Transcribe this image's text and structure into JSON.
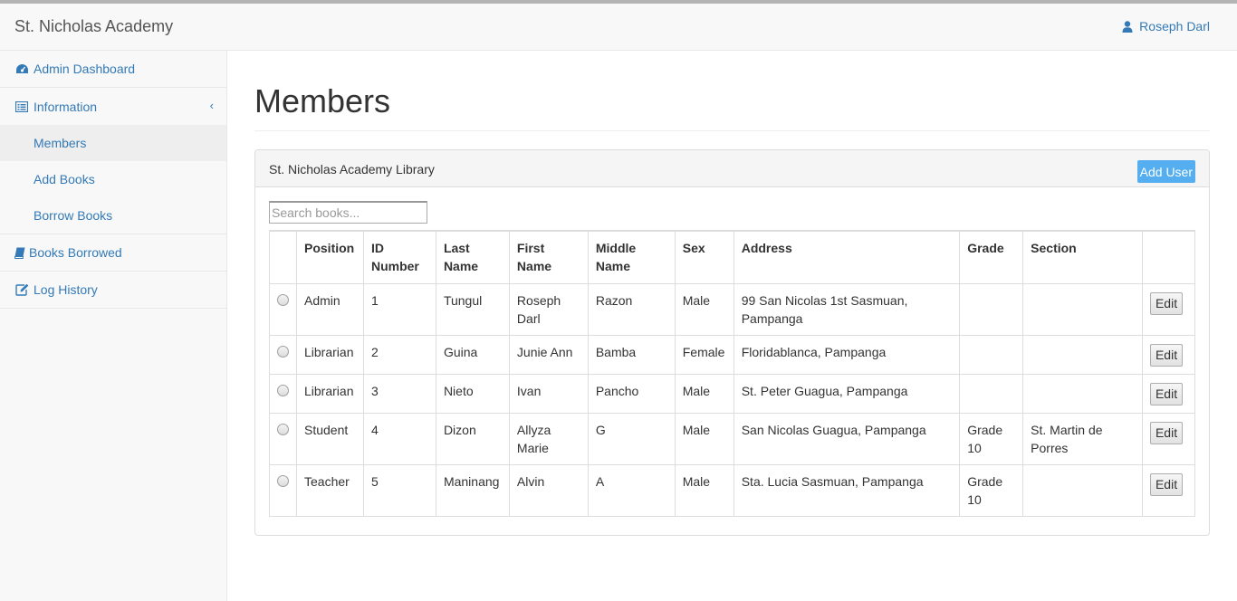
{
  "app": {
    "brand": "St. Nicholas Academy",
    "user_name": "Roseph Darl"
  },
  "sidebar": {
    "items": [
      {
        "label": "Admin Dashboard",
        "icon": "dashboard-icon"
      },
      {
        "label": "Information",
        "icon": "list-alt-icon"
      },
      {
        "label": "Members",
        "icon": ""
      },
      {
        "label": "Add Books",
        "icon": ""
      },
      {
        "label": "Borrow Books",
        "icon": ""
      },
      {
        "label": "Books Borrowed",
        "icon": "book-icon"
      },
      {
        "label": "Log History",
        "icon": "edit-icon"
      }
    ],
    "chevron": "‹"
  },
  "main": {
    "title": "Members",
    "panel_title": "St. Nicholas Academy Library",
    "add_button": "Add User",
    "search_placeholder": "Search books...",
    "columns": [
      {
        "l1": "Position",
        "l2": ""
      },
      {
        "l1": "ID",
        "l2": "Number"
      },
      {
        "l1": "Last",
        "l2": "Name"
      },
      {
        "l1": "First",
        "l2": "Name"
      },
      {
        "l1": "Middle",
        "l2": "Name"
      },
      {
        "l1": "Sex",
        "l2": ""
      },
      {
        "l1": "Address",
        "l2": ""
      },
      {
        "l1": "Grade",
        "l2": ""
      },
      {
        "l1": "Section",
        "l2": ""
      }
    ],
    "edit_label": "Edit",
    "rows": [
      {
        "position": "Admin",
        "id": "1",
        "last": "Tungul",
        "first": "Roseph Darl",
        "middle": "Razon",
        "sex": "Male",
        "address": "99 San Nicolas 1st Sasmuan, Pampanga",
        "grade": "",
        "section": ""
      },
      {
        "position": "Librarian",
        "id": "2",
        "last": "Guina",
        "first": "Junie Ann",
        "middle": "Bamba",
        "sex": "Female",
        "address": "Floridablanca, Pampanga",
        "grade": "",
        "section": ""
      },
      {
        "position": "Librarian",
        "id": "3",
        "last": "Nieto",
        "first": "Ivan",
        "middle": "Pancho",
        "sex": "Male",
        "address": "St. Peter Guagua, Pampanga",
        "grade": "",
        "section": ""
      },
      {
        "position": "Student",
        "id": "4",
        "last": "Dizon",
        "first": "Allyza Marie",
        "middle": "G",
        "sex": "Male",
        "address": "San Nicolas Guagua, Pampanga",
        "grade": "Grade 10",
        "section": "St. Martin de Porres"
      },
      {
        "position": "Teacher",
        "id": "5",
        "last": "Maninang",
        "first": "Alvin",
        "middle": "A",
        "sex": "Male",
        "address": "Sta. Lucia Sasmuan, Pampanga",
        "grade": "Grade 10",
        "section": ""
      }
    ]
  },
  "colors": {
    "link": "#337ab7",
    "add_button": "#55aef0",
    "sidebar_bg": "#f8f8f8"
  }
}
